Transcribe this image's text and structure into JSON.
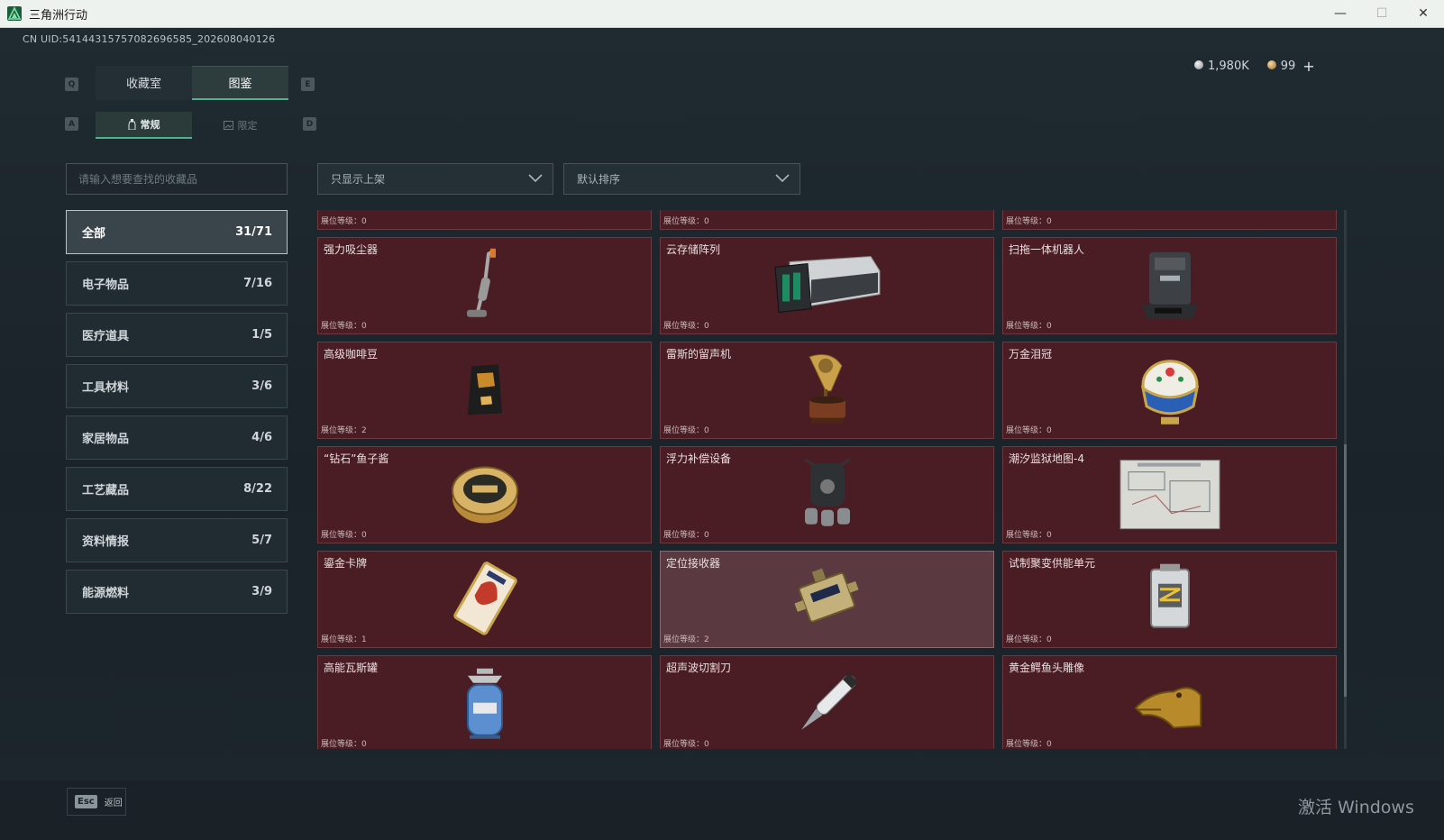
{
  "window": {
    "title": "三角洲行动",
    "minimize": "—",
    "maximize": "☐",
    "close": "✕"
  },
  "uid": "CN UID:541443157570826965​85_202608040126",
  "keys": {
    "q": "Q",
    "e": "E",
    "a": "A",
    "d": "D"
  },
  "main_tabs": [
    {
      "label": "收藏室",
      "active": false
    },
    {
      "label": "图鉴",
      "active": true
    }
  ],
  "sub_tabs": [
    {
      "label": "常规",
      "active": true
    },
    {
      "label": "限定",
      "active": false
    }
  ],
  "currency": {
    "silver": "1,980K",
    "gold": "99",
    "plus": "+"
  },
  "search": {
    "placeholder": "请输入想要查找的收藏品"
  },
  "filters": {
    "show": "只显示上架",
    "sort": "默认排序"
  },
  "categories": [
    {
      "label": "全部",
      "count": "31/71",
      "active": true
    },
    {
      "label": "电子物品",
      "count": "7/16",
      "active": false
    },
    {
      "label": "医疗道具",
      "count": "1/5",
      "active": false
    },
    {
      "label": "工具材料",
      "count": "3/6",
      "active": false
    },
    {
      "label": "家居物品",
      "count": "4/6",
      "active": false
    },
    {
      "label": "工艺藏品",
      "count": "8/22",
      "active": false
    },
    {
      "label": "资料情报",
      "count": "5/7",
      "active": false
    },
    {
      "label": "能源燃料",
      "count": "3/9",
      "active": false
    }
  ],
  "level_label": "展位等级：",
  "items": [
    {
      "name": "",
      "level": "0",
      "icon": "partial-item-icon"
    },
    {
      "name": "",
      "level": "0",
      "icon": "partial-item-icon"
    },
    {
      "name": "",
      "level": "0",
      "icon": "partial-item-icon"
    },
    {
      "name": "强力吸尘器",
      "level": "0",
      "icon": "vacuum-cleaner-icon"
    },
    {
      "name": "云存储阵列",
      "level": "0",
      "icon": "storage-array-icon"
    },
    {
      "name": "扫拖一体机器人",
      "level": "0",
      "icon": "mop-robot-icon"
    },
    {
      "name": "高级咖啡豆",
      "level": "2",
      "icon": "coffee-bag-icon"
    },
    {
      "name": "雷斯的留声机",
      "level": "0",
      "icon": "gramophone-icon"
    },
    {
      "name": "万金泪冠",
      "level": "0",
      "icon": "jeweled-egg-icon"
    },
    {
      "name": "“钻石”鱼子酱",
      "level": "0",
      "icon": "caviar-tin-icon"
    },
    {
      "name": "浮力补偿设备",
      "level": "0",
      "icon": "buoyancy-device-icon"
    },
    {
      "name": "潮汐监狱地图-4",
      "level": "0",
      "icon": "map-icon"
    },
    {
      "name": "鎏金卡牌",
      "level": "1",
      "icon": "gilded-card-icon"
    },
    {
      "name": "定位接收器",
      "level": "2",
      "icon": "receiver-icon",
      "highlight": true
    },
    {
      "name": "试制聚变供能单元",
      "level": "0",
      "icon": "fusion-cell-icon"
    },
    {
      "name": "高能瓦斯罐",
      "level": "0",
      "icon": "gas-canister-icon"
    },
    {
      "name": "超声波切割刀",
      "level": "0",
      "icon": "ultrasonic-knife-icon"
    },
    {
      "name": "黄金鳄鱼头雕像",
      "level": "0",
      "icon": "croc-statue-icon"
    }
  ],
  "footer": {
    "esc_key": "Esc",
    "esc_label": "返回"
  },
  "watermark": "激活 Windows",
  "colors": {
    "card_bg": "#4a1d24",
    "accent": "#4fb28a"
  }
}
